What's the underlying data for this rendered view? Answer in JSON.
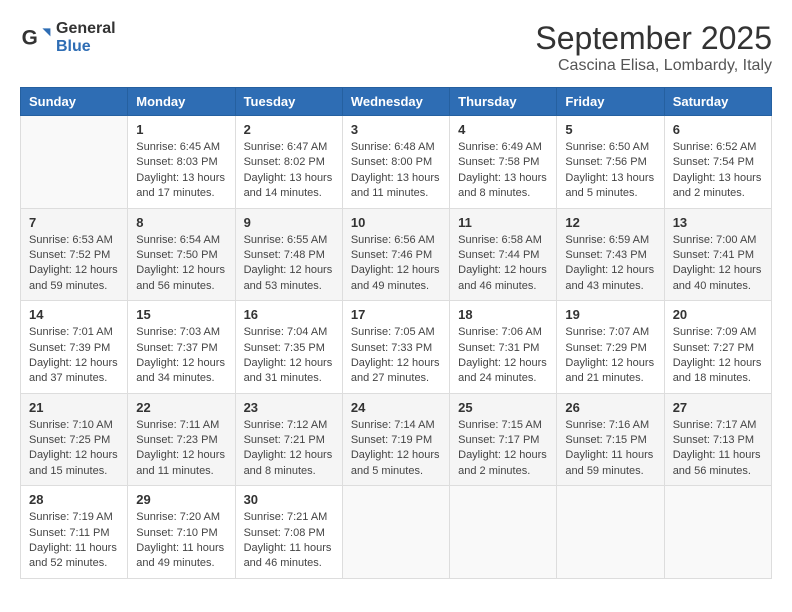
{
  "header": {
    "logo_general": "General",
    "logo_blue": "Blue",
    "month_title": "September 2025",
    "location": "Cascina Elisa, Lombardy, Italy"
  },
  "days_of_week": [
    "Sunday",
    "Monday",
    "Tuesday",
    "Wednesday",
    "Thursday",
    "Friday",
    "Saturday"
  ],
  "weeks": [
    [
      {
        "day": "",
        "content": ""
      },
      {
        "day": "1",
        "content": "Sunrise: 6:45 AM\nSunset: 8:03 PM\nDaylight: 13 hours\nand 17 minutes."
      },
      {
        "day": "2",
        "content": "Sunrise: 6:47 AM\nSunset: 8:02 PM\nDaylight: 13 hours\nand 14 minutes."
      },
      {
        "day": "3",
        "content": "Sunrise: 6:48 AM\nSunset: 8:00 PM\nDaylight: 13 hours\nand 11 minutes."
      },
      {
        "day": "4",
        "content": "Sunrise: 6:49 AM\nSunset: 7:58 PM\nDaylight: 13 hours\nand 8 minutes."
      },
      {
        "day": "5",
        "content": "Sunrise: 6:50 AM\nSunset: 7:56 PM\nDaylight: 13 hours\nand 5 minutes."
      },
      {
        "day": "6",
        "content": "Sunrise: 6:52 AM\nSunset: 7:54 PM\nDaylight: 13 hours\nand 2 minutes."
      }
    ],
    [
      {
        "day": "7",
        "content": "Sunrise: 6:53 AM\nSunset: 7:52 PM\nDaylight: 12 hours\nand 59 minutes."
      },
      {
        "day": "8",
        "content": "Sunrise: 6:54 AM\nSunset: 7:50 PM\nDaylight: 12 hours\nand 56 minutes."
      },
      {
        "day": "9",
        "content": "Sunrise: 6:55 AM\nSunset: 7:48 PM\nDaylight: 12 hours\nand 53 minutes."
      },
      {
        "day": "10",
        "content": "Sunrise: 6:56 AM\nSunset: 7:46 PM\nDaylight: 12 hours\nand 49 minutes."
      },
      {
        "day": "11",
        "content": "Sunrise: 6:58 AM\nSunset: 7:44 PM\nDaylight: 12 hours\nand 46 minutes."
      },
      {
        "day": "12",
        "content": "Sunrise: 6:59 AM\nSunset: 7:43 PM\nDaylight: 12 hours\nand 43 minutes."
      },
      {
        "day": "13",
        "content": "Sunrise: 7:00 AM\nSunset: 7:41 PM\nDaylight: 12 hours\nand 40 minutes."
      }
    ],
    [
      {
        "day": "14",
        "content": "Sunrise: 7:01 AM\nSunset: 7:39 PM\nDaylight: 12 hours\nand 37 minutes."
      },
      {
        "day": "15",
        "content": "Sunrise: 7:03 AM\nSunset: 7:37 PM\nDaylight: 12 hours\nand 34 minutes."
      },
      {
        "day": "16",
        "content": "Sunrise: 7:04 AM\nSunset: 7:35 PM\nDaylight: 12 hours\nand 31 minutes."
      },
      {
        "day": "17",
        "content": "Sunrise: 7:05 AM\nSunset: 7:33 PM\nDaylight: 12 hours\nand 27 minutes."
      },
      {
        "day": "18",
        "content": "Sunrise: 7:06 AM\nSunset: 7:31 PM\nDaylight: 12 hours\nand 24 minutes."
      },
      {
        "day": "19",
        "content": "Sunrise: 7:07 AM\nSunset: 7:29 PM\nDaylight: 12 hours\nand 21 minutes."
      },
      {
        "day": "20",
        "content": "Sunrise: 7:09 AM\nSunset: 7:27 PM\nDaylight: 12 hours\nand 18 minutes."
      }
    ],
    [
      {
        "day": "21",
        "content": "Sunrise: 7:10 AM\nSunset: 7:25 PM\nDaylight: 12 hours\nand 15 minutes."
      },
      {
        "day": "22",
        "content": "Sunrise: 7:11 AM\nSunset: 7:23 PM\nDaylight: 12 hours\nand 11 minutes."
      },
      {
        "day": "23",
        "content": "Sunrise: 7:12 AM\nSunset: 7:21 PM\nDaylight: 12 hours\nand 8 minutes."
      },
      {
        "day": "24",
        "content": "Sunrise: 7:14 AM\nSunset: 7:19 PM\nDaylight: 12 hours\nand 5 minutes."
      },
      {
        "day": "25",
        "content": "Sunrise: 7:15 AM\nSunset: 7:17 PM\nDaylight: 12 hours\nand 2 minutes."
      },
      {
        "day": "26",
        "content": "Sunrise: 7:16 AM\nSunset: 7:15 PM\nDaylight: 11 hours\nand 59 minutes."
      },
      {
        "day": "27",
        "content": "Sunrise: 7:17 AM\nSunset: 7:13 PM\nDaylight: 11 hours\nand 56 minutes."
      }
    ],
    [
      {
        "day": "28",
        "content": "Sunrise: 7:19 AM\nSunset: 7:11 PM\nDaylight: 11 hours\nand 52 minutes."
      },
      {
        "day": "29",
        "content": "Sunrise: 7:20 AM\nSunset: 7:10 PM\nDaylight: 11 hours\nand 49 minutes."
      },
      {
        "day": "30",
        "content": "Sunrise: 7:21 AM\nSunset: 7:08 PM\nDaylight: 11 hours\nand 46 minutes."
      },
      {
        "day": "",
        "content": ""
      },
      {
        "day": "",
        "content": ""
      },
      {
        "day": "",
        "content": ""
      },
      {
        "day": "",
        "content": ""
      }
    ]
  ]
}
